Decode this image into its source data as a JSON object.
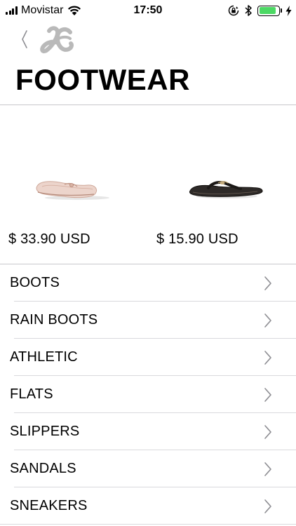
{
  "status_bar": {
    "carrier": "Movistar",
    "time": "17:50",
    "battery_level": 0.9,
    "battery_color": "#4cd964"
  },
  "header": {
    "back_icon": "chevron-left-icon",
    "logo": "brand-logo",
    "title": "FOOTWEAR"
  },
  "products": [
    {
      "image": "pink-ballet-flat",
      "price": "$ 33.90 USD"
    },
    {
      "image": "black-flip-flop-sandal",
      "price": "$ 15.90 USD"
    }
  ],
  "categories": [
    {
      "label": "BOOTS"
    },
    {
      "label": "RAIN BOOTS"
    },
    {
      "label": "ATHLETIC"
    },
    {
      "label": "FLATS"
    },
    {
      "label": "SLIPPERS"
    },
    {
      "label": "SANDALS"
    },
    {
      "label": "SNEAKERS"
    }
  ],
  "colors": {
    "divider": "#c8c7cc",
    "chevron": "#8e8e93",
    "logo": "#b9b9b9"
  }
}
